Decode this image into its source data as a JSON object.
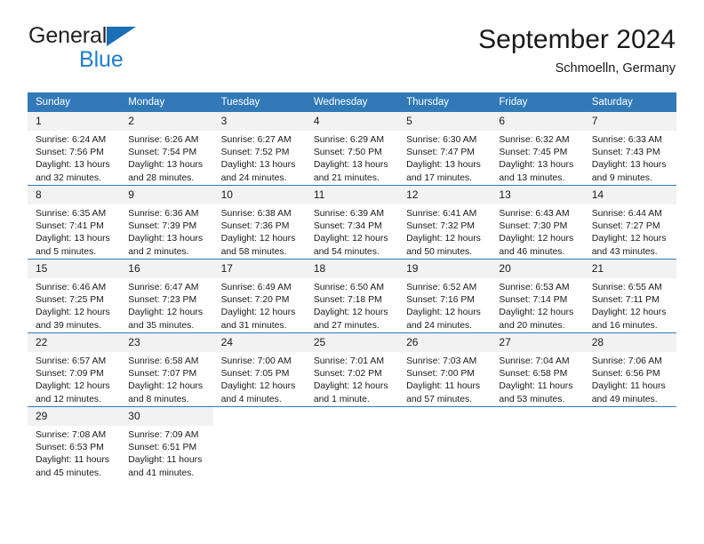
{
  "brand": {
    "word1": "General",
    "word2": "Blue",
    "triangle_color": "#1a6fb5",
    "blue_color": "#1b7fd4"
  },
  "header": {
    "title": "September 2024",
    "subtitle": "Schmoelln, Germany"
  },
  "theme": {
    "header_bg": "#3179b7",
    "daynum_bg": "#f2f2f2",
    "text": "#1a1a1a"
  },
  "calendar": {
    "weekday_headers": [
      "Sunday",
      "Monday",
      "Tuesday",
      "Wednesday",
      "Thursday",
      "Friday",
      "Saturday"
    ],
    "labels": {
      "sunrise": "Sunrise:",
      "sunset": "Sunset:",
      "daylight": "Daylight:"
    },
    "weeks": [
      [
        {
          "day": "1",
          "sunrise": "Sunrise: 6:24 AM",
          "sunset": "Sunset: 7:56 PM",
          "daylight_l1": "Daylight: 13 hours",
          "daylight_l2": "and 32 minutes."
        },
        {
          "day": "2",
          "sunrise": "Sunrise: 6:26 AM",
          "sunset": "Sunset: 7:54 PM",
          "daylight_l1": "Daylight: 13 hours",
          "daylight_l2": "and 28 minutes."
        },
        {
          "day": "3",
          "sunrise": "Sunrise: 6:27 AM",
          "sunset": "Sunset: 7:52 PM",
          "daylight_l1": "Daylight: 13 hours",
          "daylight_l2": "and 24 minutes."
        },
        {
          "day": "4",
          "sunrise": "Sunrise: 6:29 AM",
          "sunset": "Sunset: 7:50 PM",
          "daylight_l1": "Daylight: 13 hours",
          "daylight_l2": "and 21 minutes."
        },
        {
          "day": "5",
          "sunrise": "Sunrise: 6:30 AM",
          "sunset": "Sunset: 7:47 PM",
          "daylight_l1": "Daylight: 13 hours",
          "daylight_l2": "and 17 minutes."
        },
        {
          "day": "6",
          "sunrise": "Sunrise: 6:32 AM",
          "sunset": "Sunset: 7:45 PM",
          "daylight_l1": "Daylight: 13 hours",
          "daylight_l2": "and 13 minutes."
        },
        {
          "day": "7",
          "sunrise": "Sunrise: 6:33 AM",
          "sunset": "Sunset: 7:43 PM",
          "daylight_l1": "Daylight: 13 hours",
          "daylight_l2": "and 9 minutes."
        }
      ],
      [
        {
          "day": "8",
          "sunrise": "Sunrise: 6:35 AM",
          "sunset": "Sunset: 7:41 PM",
          "daylight_l1": "Daylight: 13 hours",
          "daylight_l2": "and 5 minutes."
        },
        {
          "day": "9",
          "sunrise": "Sunrise: 6:36 AM",
          "sunset": "Sunset: 7:39 PM",
          "daylight_l1": "Daylight: 13 hours",
          "daylight_l2": "and 2 minutes."
        },
        {
          "day": "10",
          "sunrise": "Sunrise: 6:38 AM",
          "sunset": "Sunset: 7:36 PM",
          "daylight_l1": "Daylight: 12 hours",
          "daylight_l2": "and 58 minutes."
        },
        {
          "day": "11",
          "sunrise": "Sunrise: 6:39 AM",
          "sunset": "Sunset: 7:34 PM",
          "daylight_l1": "Daylight: 12 hours",
          "daylight_l2": "and 54 minutes."
        },
        {
          "day": "12",
          "sunrise": "Sunrise: 6:41 AM",
          "sunset": "Sunset: 7:32 PM",
          "daylight_l1": "Daylight: 12 hours",
          "daylight_l2": "and 50 minutes."
        },
        {
          "day": "13",
          "sunrise": "Sunrise: 6:43 AM",
          "sunset": "Sunset: 7:30 PM",
          "daylight_l1": "Daylight: 12 hours",
          "daylight_l2": "and 46 minutes."
        },
        {
          "day": "14",
          "sunrise": "Sunrise: 6:44 AM",
          "sunset": "Sunset: 7:27 PM",
          "daylight_l1": "Daylight: 12 hours",
          "daylight_l2": "and 43 minutes."
        }
      ],
      [
        {
          "day": "15",
          "sunrise": "Sunrise: 6:46 AM",
          "sunset": "Sunset: 7:25 PM",
          "daylight_l1": "Daylight: 12 hours",
          "daylight_l2": "and 39 minutes."
        },
        {
          "day": "16",
          "sunrise": "Sunrise: 6:47 AM",
          "sunset": "Sunset: 7:23 PM",
          "daylight_l1": "Daylight: 12 hours",
          "daylight_l2": "and 35 minutes."
        },
        {
          "day": "17",
          "sunrise": "Sunrise: 6:49 AM",
          "sunset": "Sunset: 7:20 PM",
          "daylight_l1": "Daylight: 12 hours",
          "daylight_l2": "and 31 minutes."
        },
        {
          "day": "18",
          "sunrise": "Sunrise: 6:50 AM",
          "sunset": "Sunset: 7:18 PM",
          "daylight_l1": "Daylight: 12 hours",
          "daylight_l2": "and 27 minutes."
        },
        {
          "day": "19",
          "sunrise": "Sunrise: 6:52 AM",
          "sunset": "Sunset: 7:16 PM",
          "daylight_l1": "Daylight: 12 hours",
          "daylight_l2": "and 24 minutes."
        },
        {
          "day": "20",
          "sunrise": "Sunrise: 6:53 AM",
          "sunset": "Sunset: 7:14 PM",
          "daylight_l1": "Daylight: 12 hours",
          "daylight_l2": "and 20 minutes."
        },
        {
          "day": "21",
          "sunrise": "Sunrise: 6:55 AM",
          "sunset": "Sunset: 7:11 PM",
          "daylight_l1": "Daylight: 12 hours",
          "daylight_l2": "and 16 minutes."
        }
      ],
      [
        {
          "day": "22",
          "sunrise": "Sunrise: 6:57 AM",
          "sunset": "Sunset: 7:09 PM",
          "daylight_l1": "Daylight: 12 hours",
          "daylight_l2": "and 12 minutes."
        },
        {
          "day": "23",
          "sunrise": "Sunrise: 6:58 AM",
          "sunset": "Sunset: 7:07 PM",
          "daylight_l1": "Daylight: 12 hours",
          "daylight_l2": "and 8 minutes."
        },
        {
          "day": "24",
          "sunrise": "Sunrise: 7:00 AM",
          "sunset": "Sunset: 7:05 PM",
          "daylight_l1": "Daylight: 12 hours",
          "daylight_l2": "and 4 minutes."
        },
        {
          "day": "25",
          "sunrise": "Sunrise: 7:01 AM",
          "sunset": "Sunset: 7:02 PM",
          "daylight_l1": "Daylight: 12 hours",
          "daylight_l2": "and 1 minute."
        },
        {
          "day": "26",
          "sunrise": "Sunrise: 7:03 AM",
          "sunset": "Sunset: 7:00 PM",
          "daylight_l1": "Daylight: 11 hours",
          "daylight_l2": "and 57 minutes."
        },
        {
          "day": "27",
          "sunrise": "Sunrise: 7:04 AM",
          "sunset": "Sunset: 6:58 PM",
          "daylight_l1": "Daylight: 11 hours",
          "daylight_l2": "and 53 minutes."
        },
        {
          "day": "28",
          "sunrise": "Sunrise: 7:06 AM",
          "sunset": "Sunset: 6:56 PM",
          "daylight_l1": "Daylight: 11 hours",
          "daylight_l2": "and 49 minutes."
        }
      ],
      [
        {
          "day": "29",
          "sunrise": "Sunrise: 7:08 AM",
          "sunset": "Sunset: 6:53 PM",
          "daylight_l1": "Daylight: 11 hours",
          "daylight_l2": "and 45 minutes."
        },
        {
          "day": "30",
          "sunrise": "Sunrise: 7:09 AM",
          "sunset": "Sunset: 6:51 PM",
          "daylight_l1": "Daylight: 11 hours",
          "daylight_l2": "and 41 minutes."
        },
        {
          "day": "",
          "sunrise": "",
          "sunset": "",
          "daylight_l1": "",
          "daylight_l2": ""
        },
        {
          "day": "",
          "sunrise": "",
          "sunset": "",
          "daylight_l1": "",
          "daylight_l2": ""
        },
        {
          "day": "",
          "sunrise": "",
          "sunset": "",
          "daylight_l1": "",
          "daylight_l2": ""
        },
        {
          "day": "",
          "sunrise": "",
          "sunset": "",
          "daylight_l1": "",
          "daylight_l2": ""
        },
        {
          "day": "",
          "sunrise": "",
          "sunset": "",
          "daylight_l1": "",
          "daylight_l2": ""
        }
      ]
    ]
  }
}
